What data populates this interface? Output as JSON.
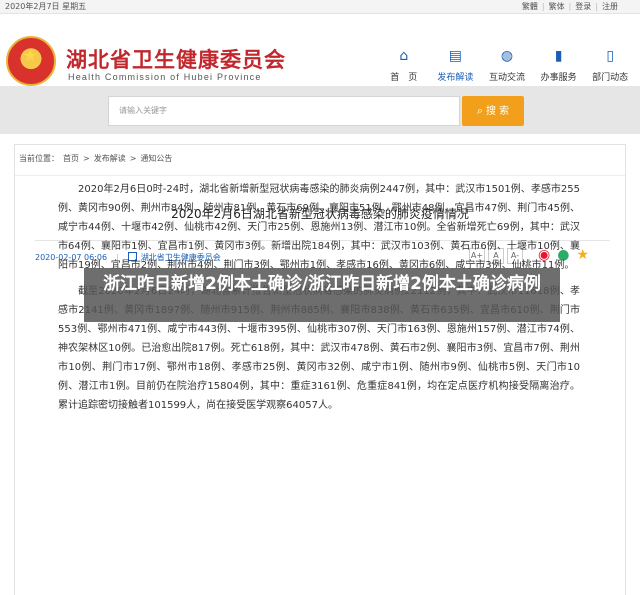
{
  "topbar": {
    "date": "2020年2月7日 星期五",
    "links": [
      "繁體",
      "繁体",
      "登录",
      "注册"
    ]
  },
  "header": {
    "title": "湖北省卫生健康委员会",
    "subtitle": "Health Commission of Hubei Province",
    "nav": [
      {
        "label": "首　页",
        "icon": "home-icon"
      },
      {
        "label": "发布解读",
        "icon": "publish-icon"
      },
      {
        "label": "互动交流",
        "icon": "chat-icon"
      },
      {
        "label": "办事服务",
        "icon": "bookmark-icon"
      },
      {
        "label": "部门动态",
        "icon": "building-icon"
      }
    ]
  },
  "search": {
    "placeholder": "请输入关键字",
    "button_label": "搜 索"
  },
  "breadcrumb": {
    "prefix": "当前位置：",
    "items": [
      "首页",
      "发布解读",
      "通知公告"
    ],
    "separator": ">"
  },
  "article": {
    "title": "2020年2月6日湖北省新型冠状病毒感染的肺炎疫情情况",
    "date": "2020-02-07 06:06",
    "source": "湖北省卫生健康委员会",
    "font_sizes": [
      "A+",
      "A",
      "A-"
    ],
    "paragraphs": [
      "2020年2月6日0时-24时，湖北省新增新型冠状病毒感染的肺炎病例2447例，其中：武汉市1501例、孝感市255例、黄冈市90例、荆州市84例、随州市81例、黄石市69例、襄阳市51例、鄂州市48例、宜昌市47例、荆门市45例、咸宁市44例、十堰市42例、仙桃市42例、天门市25例、恩施州13例、潜江市10例。全省新增死亡69例，其中：武汉市64例、襄阳市1例、宜昌市1例、黄冈市3例。新增出院184例，其中：武汉市103例、黄石市6例、十堰市10例、襄阳市19例、宜昌市2例、荆州市4例、荆门市3例、鄂州市1例、孝感市16例、黄冈市6例、咸宁市3例、仙桃市11例。",
      "截至2020年2月6日24时，湖北省累计报告新型冠状病毒感染的肺炎病例22112例，其中：武汉市11618例、孝感市2141例、黄冈市1897例、随州市915例、荆州市885例、襄阳市838例、黄石市635例、宜昌市610例、荆门市553例、鄂州市471例、咸宁市443例、十堰市395例、仙桃市307例、天门市163例、恩施州157例、潜江市74例、神农架林区10例。已治愈出院817例。死亡618例，其中：武汉市478例、黄石市2例、襄阳市3例、宜昌市7例、荆州市10例、荆门市17例、鄂州市18例、孝感市25例、黄冈市32例、咸宁市1例、随州市9例、仙桃市5例、天门市10例、潜江市1例。目前仍在院治疗15804例，其中：重症3161例、危重症841例，均在定点医疗机构接受隔离治疗。累计追踪密切接触者101599人，尚在接受医学观察64057人。"
    ]
  },
  "overlay": {
    "text": "浙江昨日新增2例本土确诊/浙江昨日新增2例本土确诊病例"
  },
  "colors": {
    "brand_red": "#c1272d",
    "nav_blue": "#1a5fb4",
    "search_orange": "#f2a01c"
  }
}
